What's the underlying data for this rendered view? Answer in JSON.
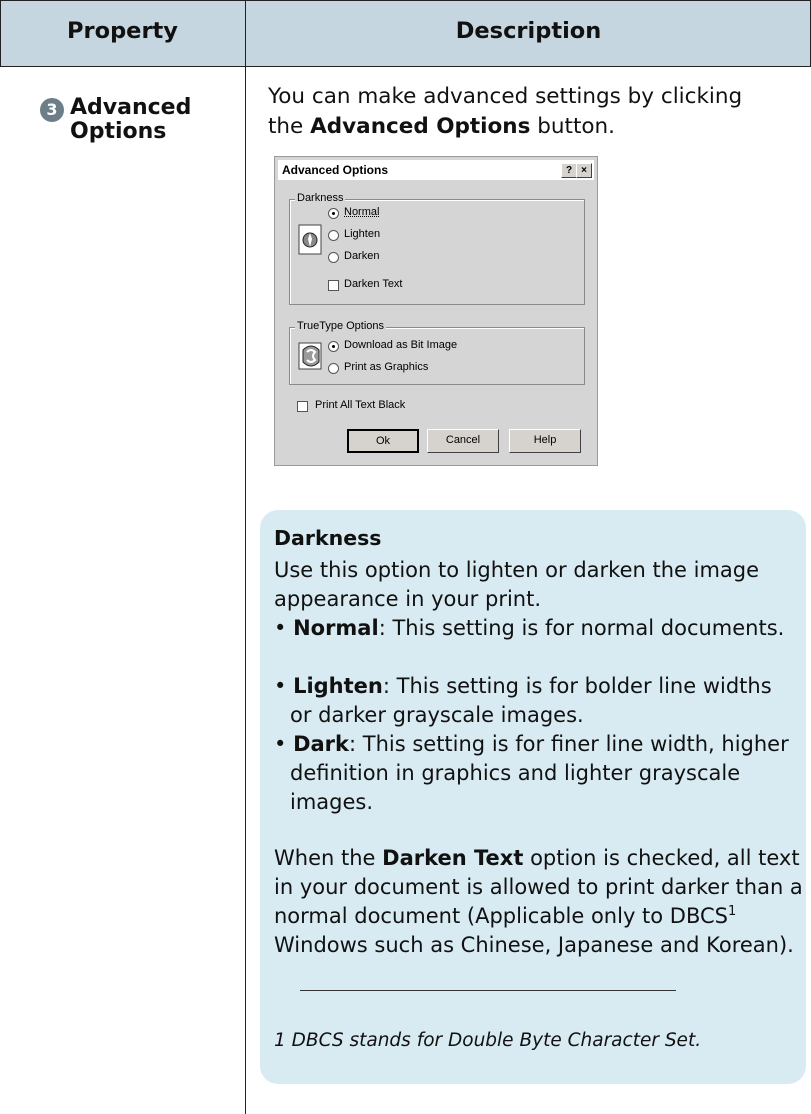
{
  "table": {
    "header_property": "Property",
    "header_description": "Description",
    "header_color": "#c6d6e0"
  },
  "row": {
    "number": "3",
    "property_name": "Advanced Options",
    "intro_prefix": "You can make advanced settings by clicking the",
    "intro_bold": "Advanced Options",
    "intro_suffix": "button."
  },
  "dialog": {
    "title": "Advanced Options",
    "help_btn": "?",
    "close_btn": "×",
    "darkness_group": "Darkness",
    "darkness_options": [
      "Normal",
      "Lighten",
      "Darken"
    ],
    "darkness_selected": "Normal",
    "darken_text": "Darken Text",
    "truetype_group": "TrueType Options",
    "truetype_options": [
      "Download as Bit Image",
      "Print as Graphics"
    ],
    "truetype_selected": "Download as Bit Image",
    "print_all_text_black": "Print All Text Black",
    "ok": "Ok",
    "cancel": "Cancel",
    "help": "Help"
  },
  "info": {
    "heading": "Darkness",
    "intro": "Use this option to lighten or darken the image appearance in your print.",
    "bullets": [
      {
        "term": "Normal",
        "text": ": This setting is for normal documents."
      },
      {
        "term": "Lighten",
        "text": ": This setting is for bolder line widths or darker grayscale images."
      },
      {
        "term": "Dark",
        "text": ": This setting is for finer line width, higher definition in graphics and lighter grayscale images."
      }
    ],
    "darken_prefix": "When the",
    "darken_bold": "Darken Text",
    "darken_suffix": "option is checked, all text in your document is allowed to print darker than a normal document (Applicable only to DBCS",
    "darken_sup": "1",
    "darken_end": " Windows such as Chinese, Japanese and Korean).",
    "footnote": "1 DBCS stands for Double Byte Character Set.",
    "box_color": "#d8eaf2"
  }
}
